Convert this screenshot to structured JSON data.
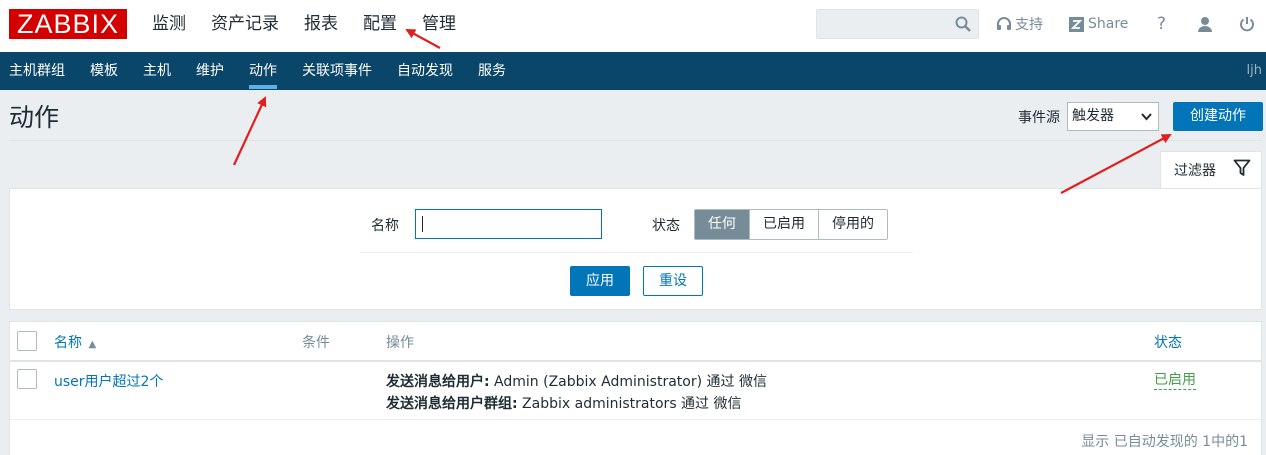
{
  "header": {
    "logo": "ZABBIX",
    "menu": [
      "监测",
      "资产记录",
      "报表",
      "配置",
      "管理"
    ],
    "active_menu": "配置",
    "search_placeholder": "",
    "support_label": "支持",
    "share_label": "Share",
    "help_label": "?"
  },
  "subnav": {
    "items": [
      "主机群组",
      "模板",
      "主机",
      "维护",
      "动作",
      "关联项事件",
      "自动发现",
      "服务"
    ],
    "active": "动作",
    "user": "ljh"
  },
  "page": {
    "title": "动作",
    "event_source_label": "事件源",
    "event_source_value": "触发器",
    "create_button": "创建动作"
  },
  "filter": {
    "tab_label": "过滤器",
    "name_label": "名称",
    "name_value": "",
    "state_label": "状态",
    "state_options": [
      "任何",
      "已启用",
      "停用的"
    ],
    "state_selected": "任何",
    "apply_button": "应用",
    "reset_button": "重设"
  },
  "table": {
    "columns": [
      "名称",
      "条件",
      "操作",
      "状态"
    ],
    "sort_column": "名称",
    "sort_indicator": "▲",
    "rows": [
      {
        "name": "user用户超过2个",
        "conditions": "",
        "operations": [
          {
            "label": "发送消息给用户:",
            "text": " Admin (Zabbix Administrator) 通过 微信"
          },
          {
            "label": "发送消息给用户群组:",
            "text": " Zabbix administrators 通过 微信"
          }
        ],
        "status": "已启用"
      }
    ],
    "footer": "显示 已自动发现的 1中的1"
  },
  "colors": {
    "logo_red": "#d40000",
    "nav_blue": "#0a466a",
    "primary_blue": "#0275b8",
    "enabled_green": "#429e47",
    "annotation_red": "#e02020"
  }
}
